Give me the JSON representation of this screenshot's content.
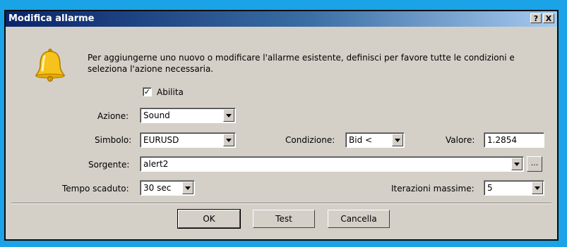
{
  "window": {
    "title": "Modifica allarme",
    "help_btn": "?",
    "close_btn": "X"
  },
  "message": "Per aggiungerne uno nuovo o modificare l'allarme esistente, definisci per favore tutte le condizioni e seleziona l'azione necessaria.",
  "enable": {
    "label": "Abilita",
    "checked": true,
    "check_glyph": "✓"
  },
  "action": {
    "label": "Azione:",
    "value": "Sound"
  },
  "symbol": {
    "label": "Simbolo:",
    "value": "EURUSD"
  },
  "condition": {
    "label": "Condizione:",
    "value": "Bid <"
  },
  "value_field": {
    "label": "Valore:",
    "value": "1.2854"
  },
  "source": {
    "label": "Sorgente:",
    "value": "alert2",
    "browse": "..."
  },
  "timeout": {
    "label": "Tempo scaduto:",
    "value": "30 sec"
  },
  "max_iterations": {
    "label": "Iterazioni massime:",
    "value": "5"
  },
  "buttons": {
    "ok": "OK",
    "test": "Test",
    "cancel": "Cancella"
  },
  "icons": {
    "dialog_icon": "bell-icon"
  }
}
